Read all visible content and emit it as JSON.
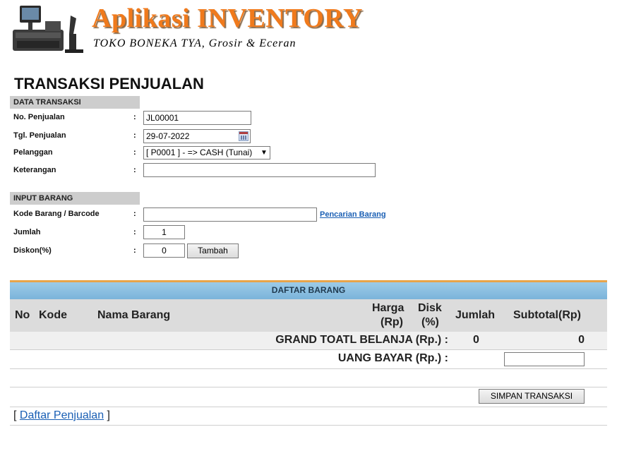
{
  "header": {
    "app_title": "Aplikasi INVENTORY",
    "subtitle": "TOKO BONEKA TYA, Grosir & Eceran",
    "logo_icon": "pos-terminal-icon"
  },
  "page_title": "TRANSAKSI PENJUALAN",
  "data_transaksi": {
    "section_title": "DATA TRANSAKSI",
    "no_penjualan_label": "No. Penjualan",
    "no_penjualan_value": "JL00001",
    "tgl_penjualan_label": "Tgl. Penjualan",
    "tgl_penjualan_value": "29-07-2022",
    "pelanggan_label": "Pelanggan",
    "pelanggan_value": "[ P0001 ] - => CASH (Tunai)",
    "keterangan_label": "Keterangan",
    "keterangan_value": "",
    "colon": ":"
  },
  "input_barang": {
    "section_title": "INPUT BARANG",
    "kode_label": "Kode Barang / Barcode",
    "kode_value": "",
    "search_link": "Pencarian Barang",
    "jumlah_label": "Jumlah",
    "jumlah_value": "1",
    "diskon_label": "Diskon(%)",
    "diskon_value": "0",
    "tambah_button": "Tambah"
  },
  "daftar_barang": {
    "title": "DAFTAR BARANG",
    "columns": {
      "no": "No",
      "kode": "Kode",
      "nama": "Nama Barang",
      "harga_1": "Harga",
      "harga_2": "(Rp)",
      "disk_1": "Disk",
      "disk_2": "(%)",
      "jumlah": "Jumlah",
      "subtotal": "Subtotal(Rp)"
    },
    "grand_total_label": "GRAND TOATL BELANJA (Rp.) :",
    "grand_total_qty": "0",
    "grand_total_value": "0",
    "uang_bayar_label": "UANG BAYAR (Rp.) :",
    "uang_bayar_value": ""
  },
  "actions": {
    "simpan_button": "SIMPAN TRANSAKSI",
    "footer_open": "[",
    "footer_link": "Daftar Penjualan",
    "footer_close": "]"
  }
}
